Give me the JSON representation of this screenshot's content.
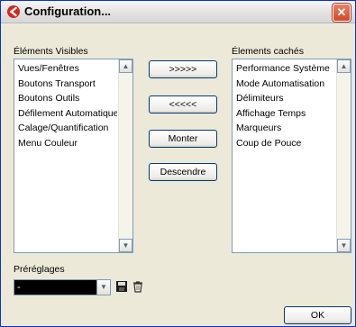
{
  "window": {
    "title": "Configuration...",
    "close_label": "✕"
  },
  "visible_list": {
    "label": "Éléments Visibles",
    "items": [
      "Vues/Fenêtres",
      "Boutons Transport",
      "Boutons Outils",
      "Défilement Automatique",
      "Calage/Quantification",
      "Menu Couleur"
    ]
  },
  "hidden_list": {
    "label": "Élements cachés",
    "items": [
      "Performance Système",
      "Mode Automatisation",
      "Délimiteurs",
      "Affichage Temps",
      "Marqueurs",
      "Coup de Pouce"
    ]
  },
  "buttons": {
    "move_right": ">>>>>",
    "move_left": "<<<<<",
    "up": "Monter",
    "down": "Descendre",
    "ok": "OK"
  },
  "presets": {
    "label": "Préréglages",
    "value": "-"
  },
  "scroll": {
    "up_arrow": "▲",
    "down_arrow": "▼",
    "combo_arrow": "▼"
  }
}
